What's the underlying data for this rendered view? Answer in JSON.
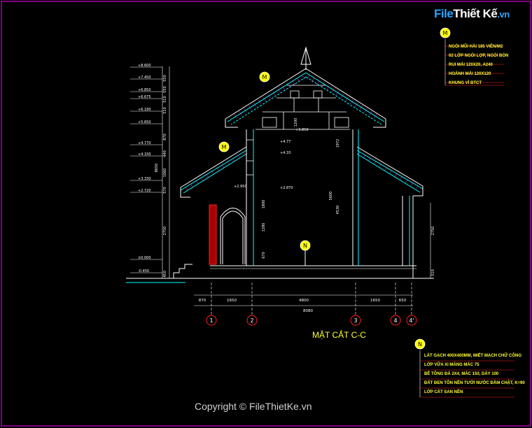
{
  "brand": {
    "part1": "File",
    "part2": "Thiết Kế",
    "part3": ".vn"
  },
  "title": "MẶT CẮT C-C",
  "copyright": "Copyright © FileThietKe.vn",
  "markers": {
    "m": "M",
    "n": "N"
  },
  "notes_m": [
    "NGÓI MŨI HÀI 185 VIÊN/M2",
    "02 LỚP NGÓI LỢP, NGÓI BÒN",
    "RUI MÁI 120X20, A240",
    "HOÀNH MÁI 120X120",
    "KHUNG VÌ BTCT"
  ],
  "notes_n": [
    "LÁT GẠCH 400X400MM, MIẾT MẠCH CHỮ CÔNG",
    "LỚP VỮA XI MĂNG MÁC 75",
    "BÊ TÔNG ĐÁ 2X4, MÁC 150, DÀY 100",
    "ĐẤT ĐEN TÔN NỀN TƯỚI NƯỚC ĐẦM CHẶT, K=90",
    "LỚP CÁT SAN NỀN"
  ],
  "axes": [
    "1",
    "2",
    "3",
    "4",
    "4'"
  ],
  "dims_bottom": [
    "870",
    "1650",
    "4800",
    "1650",
    "650"
  ],
  "dim_total": "8080",
  "levels": [
    "+8.600",
    "+7.450",
    "+6.850",
    "+6.675",
    "+6.180",
    "+5.650",
    "+4.770",
    "+4.330",
    "+3.330",
    "+2.720",
    "±0.000",
    "-0.450"
  ],
  "left_dims": [
    "550",
    "550",
    "510",
    "510",
    "870",
    "440",
    "1060",
    "8650",
    "570",
    "2750",
    "450"
  ],
  "inner_levels": [
    "+3.850",
    "+4.77",
    "+4.33",
    "+2.950",
    "+2.870"
  ],
  "inner_dims": [
    "1972",
    "5600",
    "4530",
    "1800",
    "1280",
    "670",
    "1200"
  ],
  "right_dims": [
    "2750",
    "510"
  ],
  "colors": {
    "background": "#000000",
    "frame": "#ff00ff",
    "cyan": "#00ffff",
    "white": "#ffffff",
    "yellow": "#ffff00",
    "red": "#ff2020",
    "magenta": "#ff44ff",
    "green": "#00ff66"
  }
}
